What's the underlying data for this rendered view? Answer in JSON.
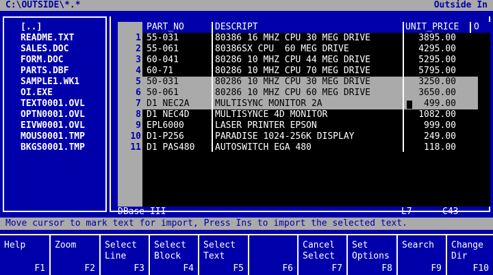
{
  "titlebar": {
    "path": "C:\\OUTSIDE\\*.*",
    "app": "Outside In"
  },
  "files": [
    "[..]",
    "README.TXT",
    "SALES.DOC",
    "FORM.DOC",
    "PARTS.DBF",
    "SAMPLE1.WK1",
    "OI.EXE",
    "TEXT0001.OVL",
    "OPTN0001.OVL",
    "EIVW0001.OVL",
    "MOUS0001.TMP",
    "BKGS0001.TMP"
  ],
  "table": {
    "columns": [
      "PART_NO",
      "DESCRIPT",
      "UNIT_PRICE",
      "O"
    ],
    "rows": [
      {
        "n": "1",
        "part": "55-031",
        "desc": "80386 16 MHZ CPU 30 MEG DRIVE",
        "price": "3895.00"
      },
      {
        "n": "2",
        "part": "55-061",
        "desc": "80386SX CPU  60 MEG DRIVE",
        "price": "4295.00"
      },
      {
        "n": "3",
        "part": "60-041",
        "desc": "80286 10 MHZ CPU 44 MEG DRIVE",
        "price": "5295.00"
      },
      {
        "n": "4",
        "part": "60-71",
        "desc": "80286 10 MHZ CPU 70 MEG DRIVE",
        "price": "5795.00"
      },
      {
        "n": "5",
        "part": "50-031",
        "desc": "80286 10 MHZ CPU 30 MEG DRIVE",
        "price": "3250.00"
      },
      {
        "n": "6",
        "part": "50-061",
        "desc": "80286 10 MHZ CPU 60 MEG DRIVE",
        "price": "3650.00"
      },
      {
        "n": "7",
        "part": "D1 NEC2A",
        "desc": "MULTISYNC MONITOR 2A",
        "price": "499.00"
      },
      {
        "n": "8",
        "part": "D1 NEC4D",
        "desc": "MULTISYNCE 4D MONITOR",
        "price": "1082.00"
      },
      {
        "n": "9",
        "part": "EPL6000",
        "desc": "LASER PRINTER EPSON",
        "price": "999.00"
      },
      {
        "n": "10",
        "part": "D1-P256",
        "desc": "PARADISE 1024-256K DISPLAY",
        "price": "249.00"
      },
      {
        "n": "11",
        "part": "D1 PAS480",
        "desc": "AUTOSWITCH EGA 480",
        "price": "118.00"
      }
    ],
    "selected_rows": [
      5,
      6,
      7
    ]
  },
  "status": {
    "format": "DBase III",
    "line": "L7",
    "col": "C43"
  },
  "message": "Move cursor to mark text for import, Press Ins to import the selected text.",
  "fkeys": [
    {
      "l1": "Help",
      "l2": "",
      "fn": "F1"
    },
    {
      "l1": "Zoom",
      "l2": "",
      "fn": "F2"
    },
    {
      "l1": "Select",
      "l2": "Line",
      "fn": "F3"
    },
    {
      "l1": "Select",
      "l2": "Block",
      "fn": "F4"
    },
    {
      "l1": "Select",
      "l2": "Text",
      "fn": "F5"
    },
    {
      "l1": "",
      "l2": "",
      "fn": "F6"
    },
    {
      "l1": "Cancel",
      "l2": "Select",
      "fn": "F7"
    },
    {
      "l1": "Set",
      "l2": "Options",
      "fn": "F8"
    },
    {
      "l1": "Search",
      "l2": "",
      "fn": "F9"
    },
    {
      "l1": "Change",
      "l2": "Dir",
      "fn": "F10"
    }
  ],
  "colors": {
    "blue": "#0000aa",
    "gray": "#aaaaaa",
    "black": "#000000",
    "white": "#ffffff"
  }
}
